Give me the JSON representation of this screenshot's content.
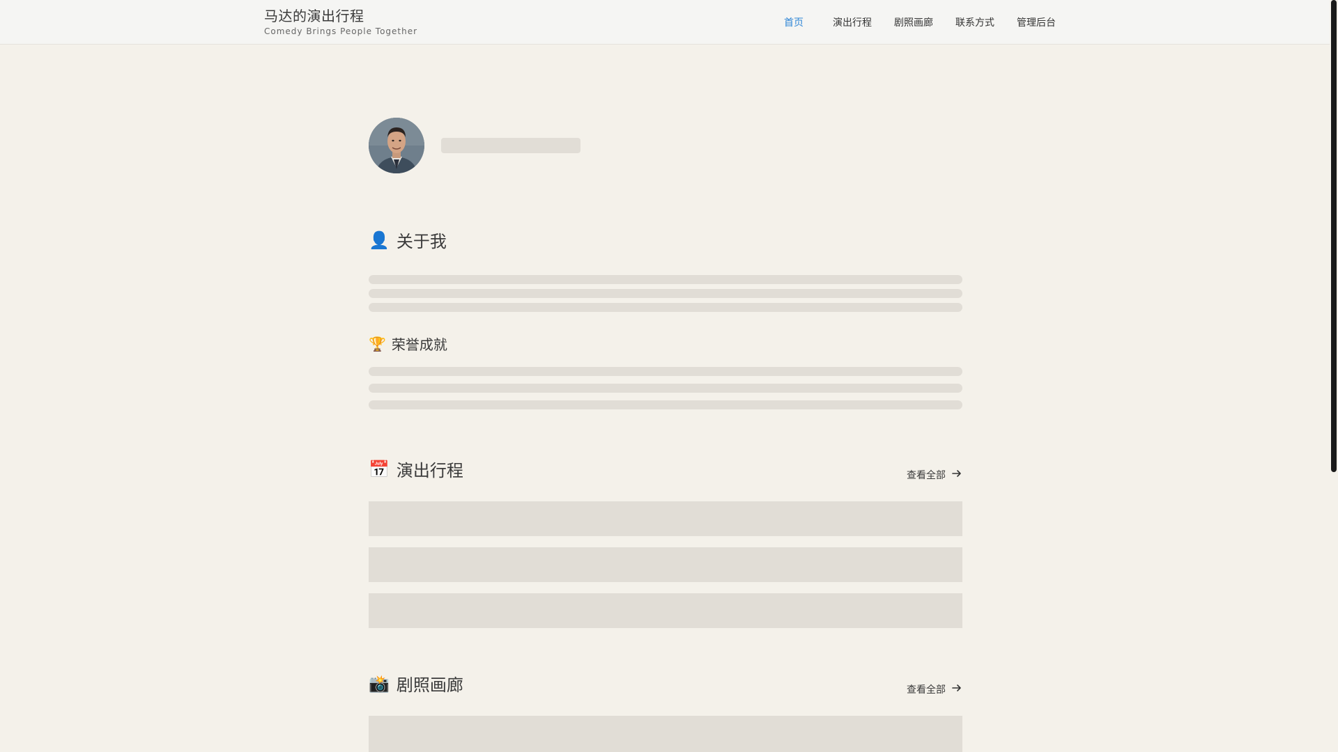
{
  "header": {
    "title": "马达的演出行程",
    "subtitle": "Comedy Brings People Together",
    "nav": [
      {
        "label": "首页",
        "active": true
      },
      {
        "label": "演出行程",
        "active": false
      },
      {
        "label": "剧照画廊",
        "active": false
      },
      {
        "label": "联系方式",
        "active": false
      },
      {
        "label": "管理后台",
        "active": false
      }
    ]
  },
  "sections": {
    "about": {
      "emoji": "👤",
      "title": "关于我"
    },
    "honors": {
      "emoji": "🏆",
      "title": "荣誉成就"
    },
    "schedule": {
      "emoji": "📅",
      "title": "演出行程",
      "view_all": "查看全部"
    },
    "gallery": {
      "emoji": "📸",
      "title": "剧照画廊",
      "view_all": "查看全部"
    }
  },
  "icons": {
    "arrow": "arrow-right-icon"
  },
  "colors": {
    "accent": "#2f86d6",
    "background": "#f4f1ea",
    "skeleton": "#e1ddd6"
  }
}
